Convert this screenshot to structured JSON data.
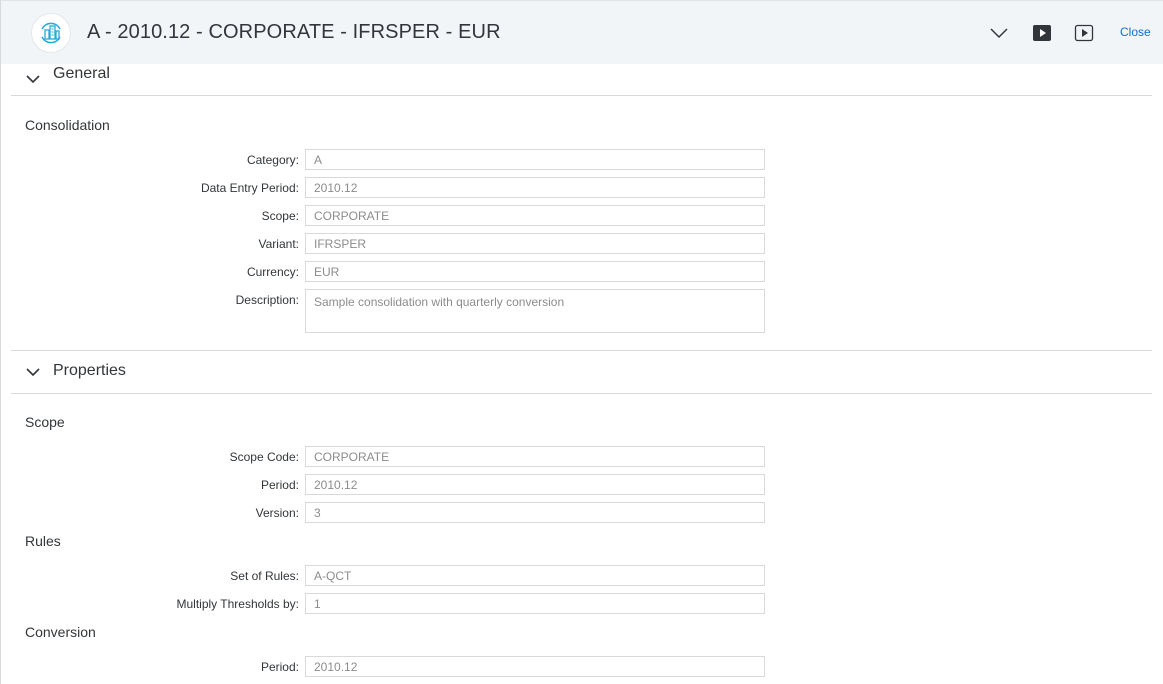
{
  "header": {
    "title": "A - 2010.12 - CORPORATE - IFRSPER - EUR",
    "close_label": "Close"
  },
  "general": {
    "title": "General",
    "group_title": "Consolidation",
    "fields": [
      {
        "label": "Category",
        "value": "A"
      },
      {
        "label": "Data Entry Period",
        "value": "2010.12"
      },
      {
        "label": "Scope",
        "value": "CORPORATE"
      },
      {
        "label": "Variant",
        "value": "IFRSPER"
      },
      {
        "label": "Currency",
        "value": "EUR"
      },
      {
        "label": "Description",
        "value": "Sample consolidation with quarterly conversion"
      }
    ]
  },
  "properties": {
    "title": "Properties",
    "scope": {
      "title": "Scope",
      "fields": [
        {
          "label": "Scope Code",
          "value": "CORPORATE"
        },
        {
          "label": "Period",
          "value": "2010.12"
        },
        {
          "label": "Version",
          "value": "3"
        }
      ]
    },
    "rules": {
      "title": "Rules",
      "fields": [
        {
          "label": "Set of Rules",
          "value": "A-QCT"
        },
        {
          "label": "Multiply Thresholds by",
          "value": "1"
        }
      ]
    },
    "conversion": {
      "title": "Conversion",
      "fields": [
        {
          "label": "Period",
          "value": "2010.12"
        }
      ]
    }
  },
  "colors": {
    "header_bg": "#f2f5f8",
    "accent": "#0a6ed1",
    "logo_accent": "#2aa8d8",
    "text": "#32363a",
    "field_text": "#8c8c8c"
  }
}
